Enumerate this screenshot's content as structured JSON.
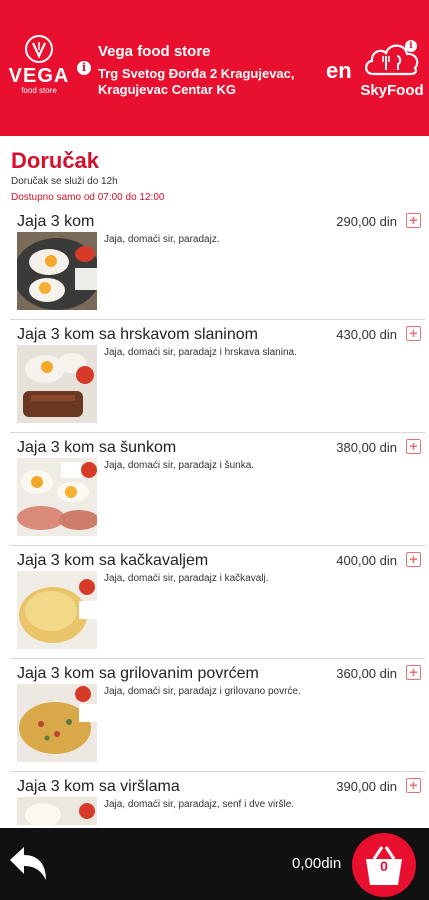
{
  "header": {
    "logo_word": "VEGA",
    "logo_sub": "food store",
    "store_name": "Vega food store",
    "address": "Trg Svetog Đorđa 2 Kragujevac, Kragujevac Centar KG",
    "info_glyph": "i",
    "lang": "en",
    "partner_logo": "SkyFood",
    "brand_color": "#e8102e"
  },
  "section": {
    "title": "Doručak",
    "note": "Doručak se služi do 12h",
    "hours": "Dostupno samo od 07:00 do 12:00"
  },
  "items": [
    {
      "name": "Jaja 3 kom",
      "price": "290,00 din",
      "desc": "Jaja, domaći sir, paradajz.",
      "add": "+",
      "image": "fried-eggs-photo"
    },
    {
      "name": "Jaja 3 kom sa hrskavom slaninom",
      "price": "430,00 din",
      "desc": "Jaja, domaći sir, paradajz i hrskava slanina.",
      "add": "+",
      "image": "eggs-bacon-photo"
    },
    {
      "name": "Jaja 3 kom sa šunkom",
      "price": "380,00 din",
      "desc": "Jaja, domaći sir, paradajz i šunka.",
      "add": "+",
      "image": "eggs-ham-photo"
    },
    {
      "name": "Jaja 3 kom sa kačkavaljem",
      "price": "400,00 din",
      "desc": "Jaja, domaći sir, paradajz i kačkavalj.",
      "add": "+",
      "image": "omelette-cheese-photo"
    },
    {
      "name": "Jaja 3 kom sa grilovanim povrćem",
      "price": "360,00 din",
      "desc": "Jaja, domaći sir, paradajz i grilovano povrće.",
      "add": "+",
      "image": "omelette-vegetables-photo"
    },
    {
      "name": "Jaja 3 kom sa viršlama",
      "price": "390,00 din",
      "desc": "Jaja, domaći sir, paradajz, senf i dve viršle.",
      "add": "+",
      "image": "eggs-sausages-photo"
    }
  ],
  "footer": {
    "back_icon": "back-arrow-icon",
    "total": "0,00din",
    "basket_count": "0"
  }
}
